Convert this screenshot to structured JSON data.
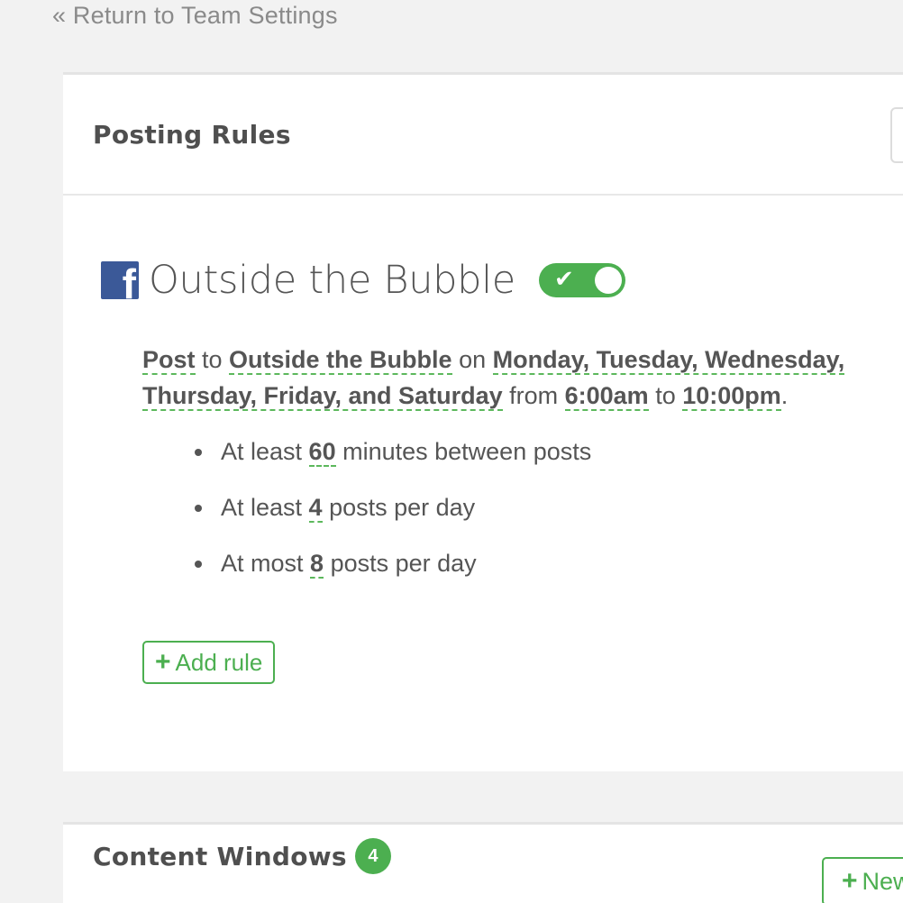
{
  "nav": {
    "back_label": "« Return to Team Settings"
  },
  "posting_rules": {
    "title": "Posting Rules",
    "account": {
      "network_icon": "facebook-icon",
      "name": "Outside the Bubble",
      "enabled": true
    },
    "sentence": {
      "action": "Post",
      "to_word": " to ",
      "target": "Outside the Bubble",
      "on_word": " on ",
      "days": "Monday, Tuesday, Wednesday, Thursday, Friday, and Saturday",
      "from_word": " from ",
      "start_time": "6:00am",
      "to_word2": " to ",
      "end_time": "10:00pm",
      "period": "."
    },
    "rules": [
      {
        "prefix": "At least ",
        "value": "60",
        "suffix": " minutes between posts"
      },
      {
        "prefix": "At least ",
        "value": "4",
        "suffix": " posts per day"
      },
      {
        "prefix": "At most ",
        "value": "8",
        "suffix": " posts per day"
      }
    ],
    "add_rule_label": "Add rule",
    "add_rule_icon": "plus-icon"
  },
  "content_windows": {
    "title": "Content Windows",
    "count": "4",
    "new_button_label": "New"
  },
  "colors": {
    "accent": "#4caf50",
    "facebook": "#3b5998",
    "text": "#555555",
    "muted": "#8a8a8a"
  }
}
